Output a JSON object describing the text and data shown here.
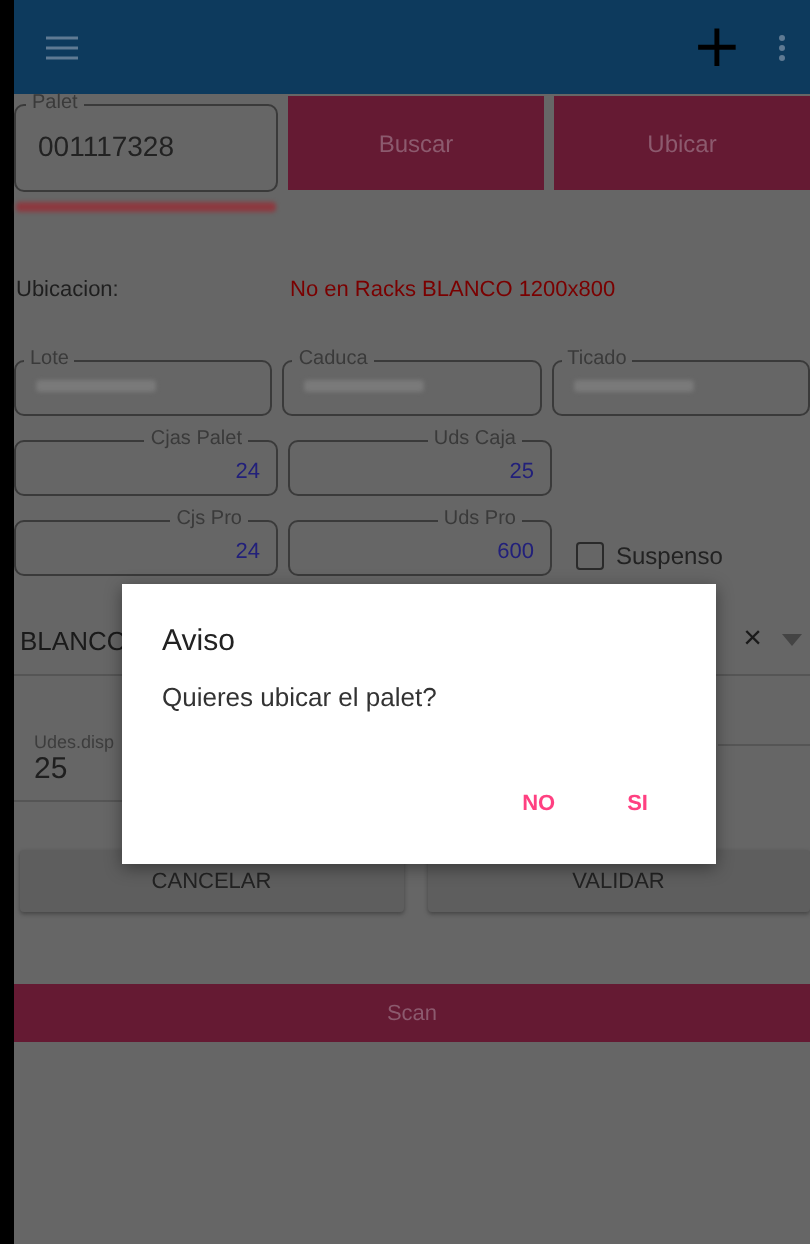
{
  "app_bar": {
    "add_label": "+"
  },
  "palet": {
    "label": "Palet",
    "value": "001117328"
  },
  "actions": [
    "Buscar",
    "Ubicar"
  ],
  "ubicacion": {
    "label": "Ubicacion:",
    "value": "No en Racks BLANCO 1200x800"
  },
  "info_fields": [
    {
      "label": "Lote"
    },
    {
      "label": "Caduca"
    },
    {
      "label": "Ticado"
    }
  ],
  "qty_rows": [
    [
      {
        "label": "Cjas Palet",
        "value": "24"
      },
      {
        "label": "Uds Caja",
        "value": "25"
      }
    ],
    [
      {
        "label": "Cjs Pro",
        "value": "24"
      },
      {
        "label": "Uds Pro",
        "value": "600"
      }
    ]
  ],
  "suspenso": {
    "label": "Suspenso",
    "checked": false
  },
  "selector": {
    "value": "BLANCO",
    "clear": "×"
  },
  "udes": {
    "label": "Udes.disp",
    "value": "25"
  },
  "buttons": [
    "CANCELAR",
    "VALIDAR"
  ],
  "scan": "Scan",
  "dialog": {
    "title": "Aviso",
    "message": "Quieres ubicar el palet?",
    "buttons": [
      "NO",
      "SI"
    ]
  }
}
